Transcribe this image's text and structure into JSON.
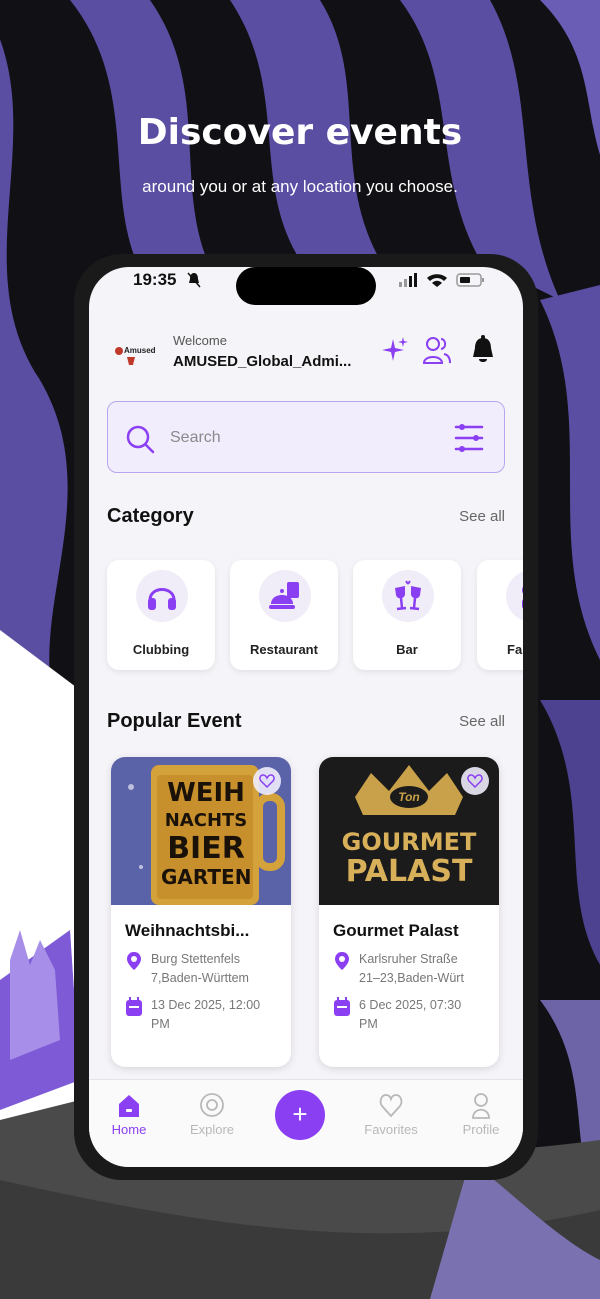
{
  "promo": {
    "title": "Discover events",
    "subtitle": "around you or at any location you choose."
  },
  "status_bar": {
    "time": "19:35"
  },
  "header": {
    "logo_text": "Amused",
    "welcome": "Welcome",
    "username": "AMUSED_Global_Admi...",
    "icons": [
      "sparkles-icon",
      "users-icon",
      "bell-icon"
    ]
  },
  "search": {
    "placeholder": "Search"
  },
  "category": {
    "title": "Category",
    "see_all": "See all",
    "items": [
      {
        "label": "Clubbing",
        "icon": "headphones-icon"
      },
      {
        "label": "Restaurant",
        "icon": "serving-dish-icon"
      },
      {
        "label": "Bar",
        "icon": "wine-glasses-icon"
      },
      {
        "label": "Fa",
        "icon": "partial-icon"
      }
    ]
  },
  "popular": {
    "title": "Popular Event",
    "see_all": "See all",
    "events": [
      {
        "title": "Weihnachtsbi...",
        "image_lines": [
          "WEIH",
          "NACHTS",
          "BIER",
          "GARTEN"
        ],
        "location_1": "Burg Stettenfels",
        "location_2": "7,Baden-Württem",
        "date_1": "13 Dec 2025, 12:00",
        "date_2": "PM"
      },
      {
        "title": "Gourmet Palast",
        "image_brand": "Ton",
        "image_lines": [
          "GOURMET",
          "PALAST"
        ],
        "location_1": "Karlsruher Straße",
        "location_2": "21–23,Baden-Würt",
        "date_1": "6 Dec 2025, 07:30",
        "date_2": "PM"
      }
    ]
  },
  "tabs": {
    "home": "Home",
    "explore": "Explore",
    "add": "+",
    "favorites": "Favorites",
    "profile": "Profile"
  },
  "colors": {
    "accent": "#8b3ff2",
    "background_purple": "#5b4ea0",
    "screen_bg": "#f5f4f8"
  }
}
